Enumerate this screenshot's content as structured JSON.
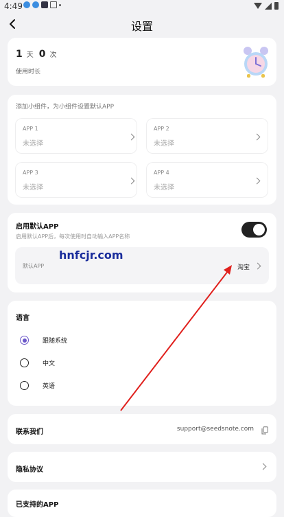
{
  "status_bar": {
    "time": "4:49"
  },
  "header": {
    "title": "设置"
  },
  "usage": {
    "days": "1",
    "days_unit": "天",
    "times": "0",
    "times_unit": "次",
    "label": "使用时长"
  },
  "widgets": {
    "hint": "添加小组件，为小组件设置默认APP",
    "slots": [
      {
        "name": "APP 1",
        "value": "未选择"
      },
      {
        "name": "APP 2",
        "value": "未选择"
      },
      {
        "name": "APP 3",
        "value": "未选择"
      },
      {
        "name": "APP 4",
        "value": "未选择"
      }
    ]
  },
  "default_app": {
    "title": "启用默认APP",
    "description": "启用默认APP后，每次使用时自动输入APP名称",
    "enabled": true,
    "row_label": "默认APP",
    "row_value": "淘宝"
  },
  "watermark": "hnfcjr.com",
  "language": {
    "title": "语言",
    "options": [
      {
        "label": "跟随系统",
        "selected": true
      },
      {
        "label": "中文",
        "selected": false
      },
      {
        "label": "英语",
        "selected": false
      }
    ]
  },
  "contact": {
    "title": "联系我们",
    "email": "support@seedsnote.com"
  },
  "privacy": {
    "title": "隐私协议"
  },
  "supported": {
    "title": "已支持的APP"
  },
  "colors": {
    "accent": "#6b57c9",
    "annotation_arrow": "#e0201d",
    "toggle_on": "#222222"
  },
  "icons": [
    "back-arrow-icon",
    "alarm-clock-icon",
    "chevron-right-icon",
    "copy-icon"
  ]
}
